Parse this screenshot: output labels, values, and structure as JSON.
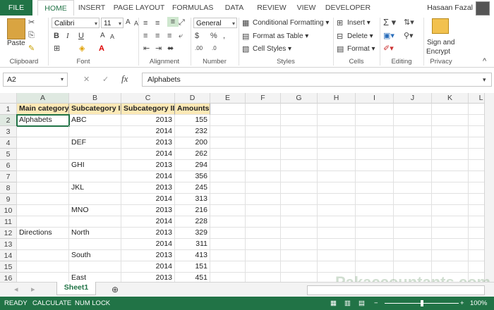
{
  "tabs": [
    "FILE",
    "HOME",
    "INSERT",
    "PAGE LAYOUT",
    "FORMULAS",
    "DATA",
    "REVIEW",
    "VIEW",
    "DEVELOPER"
  ],
  "user_name": "Hasaan Fazal",
  "ribbon": {
    "paste_label": "Paste",
    "font_name": "Calibri",
    "font_size": "11",
    "number_format": "General",
    "conditional_formatting": "Conditional Formatting",
    "format_as_table": "Format as Table",
    "cell_styles": "Cell Styles",
    "insert": "Insert",
    "delete": "Delete",
    "format": "Format",
    "sign_and": "Sign and",
    "encrypt": "Encrypt",
    "groups": [
      "Clipboard",
      "Font",
      "Alignment",
      "Number",
      "Styles",
      "Cells",
      "Editing",
      "Privacy"
    ]
  },
  "formula_bar": {
    "name_box": "A2",
    "fx": "fx",
    "content": "Alphabets"
  },
  "columns": [
    "A",
    "B",
    "C",
    "D",
    "E",
    "F",
    "G",
    "H",
    "I",
    "J",
    "K",
    "L"
  ],
  "rows": [
    [
      "Main category",
      "Subcategory I",
      "Subcategory II",
      "Amounts"
    ],
    [
      "Alphabets",
      "ABC",
      "2013",
      "155"
    ],
    [
      "",
      "",
      "2014",
      "232"
    ],
    [
      "",
      "DEF",
      "2013",
      "200"
    ],
    [
      "",
      "",
      "2014",
      "262"
    ],
    [
      "",
      "GHI",
      "2013",
      "294"
    ],
    [
      "",
      "",
      "2014",
      "356"
    ],
    [
      "",
      "JKL",
      "2013",
      "245"
    ],
    [
      "",
      "",
      "2014",
      "313"
    ],
    [
      "",
      "MNO",
      "2013",
      "216"
    ],
    [
      "",
      "",
      "2014",
      "228"
    ],
    [
      "Directions",
      "North",
      "2013",
      "329"
    ],
    [
      "",
      "",
      "2014",
      "311"
    ],
    [
      "",
      "South",
      "2013",
      "413"
    ],
    [
      "",
      "",
      "2014",
      "151"
    ],
    [
      "",
      "East",
      "2013",
      "451"
    ]
  ],
  "sheet_tab": "Sheet1",
  "status": {
    "ready": "READY",
    "calculate": "CALCULATE",
    "num_lock": "NUM LOCK",
    "zoom": "100%"
  },
  "watermark": "Pakaccountants.com"
}
